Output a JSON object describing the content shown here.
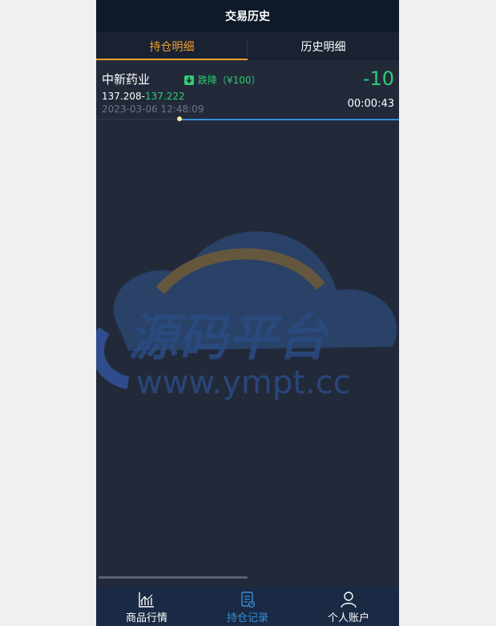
{
  "header": {
    "title": "交易历史"
  },
  "tabs": [
    {
      "label": "持仓明细",
      "active": true
    },
    {
      "label": "历史明细",
      "active": false
    }
  ],
  "position": {
    "name": "中新药业",
    "direction_label": "跌降（¥100）",
    "direction_icon": "arrow-down-icon",
    "pnl": "-10",
    "open_price": "137.208",
    "separator": "-",
    "current_price": "137.222",
    "timestamp": "2023-03-06 12:48:09",
    "countdown": "00:00:43",
    "progress_fraction": 0.27
  },
  "watermark": {
    "title": "源码平台",
    "url": "www.ympt.cc"
  },
  "nav": [
    {
      "label": "商品行情",
      "icon": "chart-icon",
      "active": false
    },
    {
      "label": "持仓记录",
      "icon": "document-icon",
      "active": true
    },
    {
      "label": "个人账户",
      "icon": "user-icon",
      "active": false
    }
  ],
  "colors": {
    "accent_tab": "#f0a030",
    "down_green": "#2ecc71",
    "active_nav": "#3a8fd8",
    "background": "#222a3a"
  }
}
